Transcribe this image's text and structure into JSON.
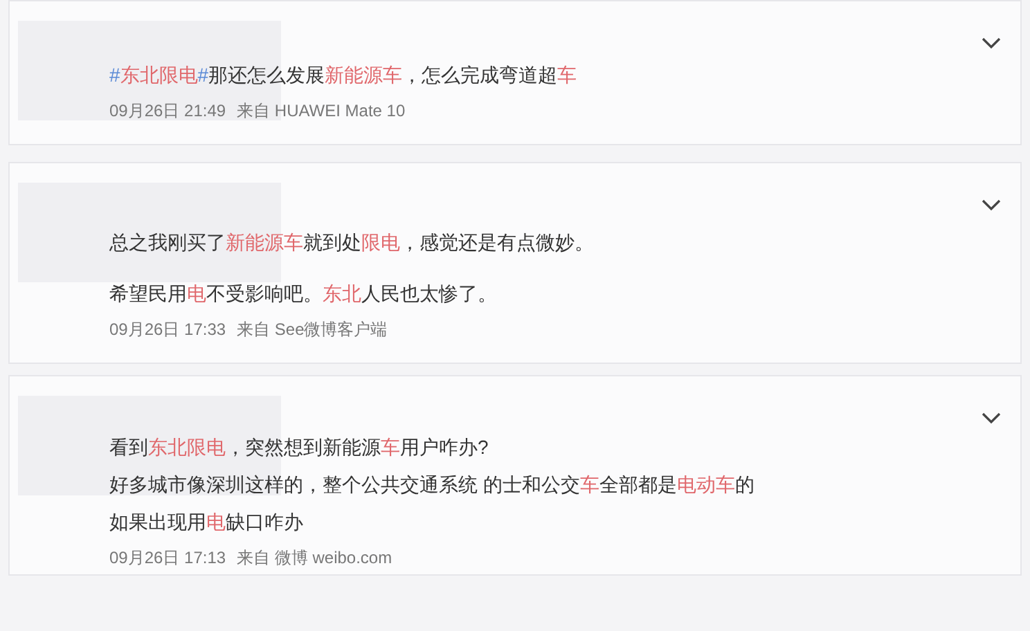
{
  "posts": [
    {
      "paragraphs": [
        [
          [
            {
              "kind": "hashtag",
              "text": "#"
            },
            {
              "kind": "keyword",
              "text": "东北限电"
            },
            {
              "kind": "hashtag",
              "text": "#"
            },
            {
              "kind": "plain",
              "text": "那还怎么发展"
            },
            {
              "kind": "keyword",
              "text": "新能源车"
            },
            {
              "kind": "plain",
              "text": "，怎么完成弯道超"
            },
            {
              "kind": "keyword",
              "text": "车"
            }
          ]
        ]
      ],
      "time": "09月26日 21:49",
      "source": "来自 HUAWEI Mate 10"
    },
    {
      "paragraphs": [
        [
          [
            {
              "kind": "plain",
              "text": "总之我刚买了"
            },
            {
              "kind": "keyword",
              "text": "新能源车"
            },
            {
              "kind": "plain",
              "text": "就到处"
            },
            {
              "kind": "keyword",
              "text": "限电"
            },
            {
              "kind": "plain",
              "text": "，感觉还是有点微妙。"
            }
          ]
        ],
        [
          [
            {
              "kind": "plain",
              "text": "希望民用"
            },
            {
              "kind": "keyword",
              "text": "电"
            },
            {
              "kind": "plain",
              "text": "不受影响吧。"
            },
            {
              "kind": "keyword",
              "text": "东北"
            },
            {
              "kind": "plain",
              "text": "人民也太惨了。"
            }
          ]
        ]
      ],
      "time": "09月26日 17:33",
      "source": "来自 See微博客户端"
    },
    {
      "paragraphs": [
        [
          [
            {
              "kind": "plain",
              "text": "看到"
            },
            {
              "kind": "keyword",
              "text": "东北限电"
            },
            {
              "kind": "plain",
              "text": "，突然想到新能源"
            },
            {
              "kind": "keyword",
              "text": "车"
            },
            {
              "kind": "plain",
              "text": "用户咋办?"
            }
          ],
          [
            {
              "kind": "plain",
              "text": "好多城市像深圳这样的，整个公共交通系统 的士和公交"
            },
            {
              "kind": "keyword",
              "text": "车"
            },
            {
              "kind": "plain",
              "text": "全部都是"
            },
            {
              "kind": "keyword",
              "text": "电动车"
            },
            {
              "kind": "plain",
              "text": "的"
            }
          ],
          [
            {
              "kind": "plain",
              "text": "如果出现用"
            },
            {
              "kind": "keyword",
              "text": "电"
            },
            {
              "kind": "plain",
              "text": "缺口咋办"
            }
          ]
        ]
      ],
      "time": "09月26日 17:13",
      "source": "来自 微博 weibo.com"
    }
  ]
}
